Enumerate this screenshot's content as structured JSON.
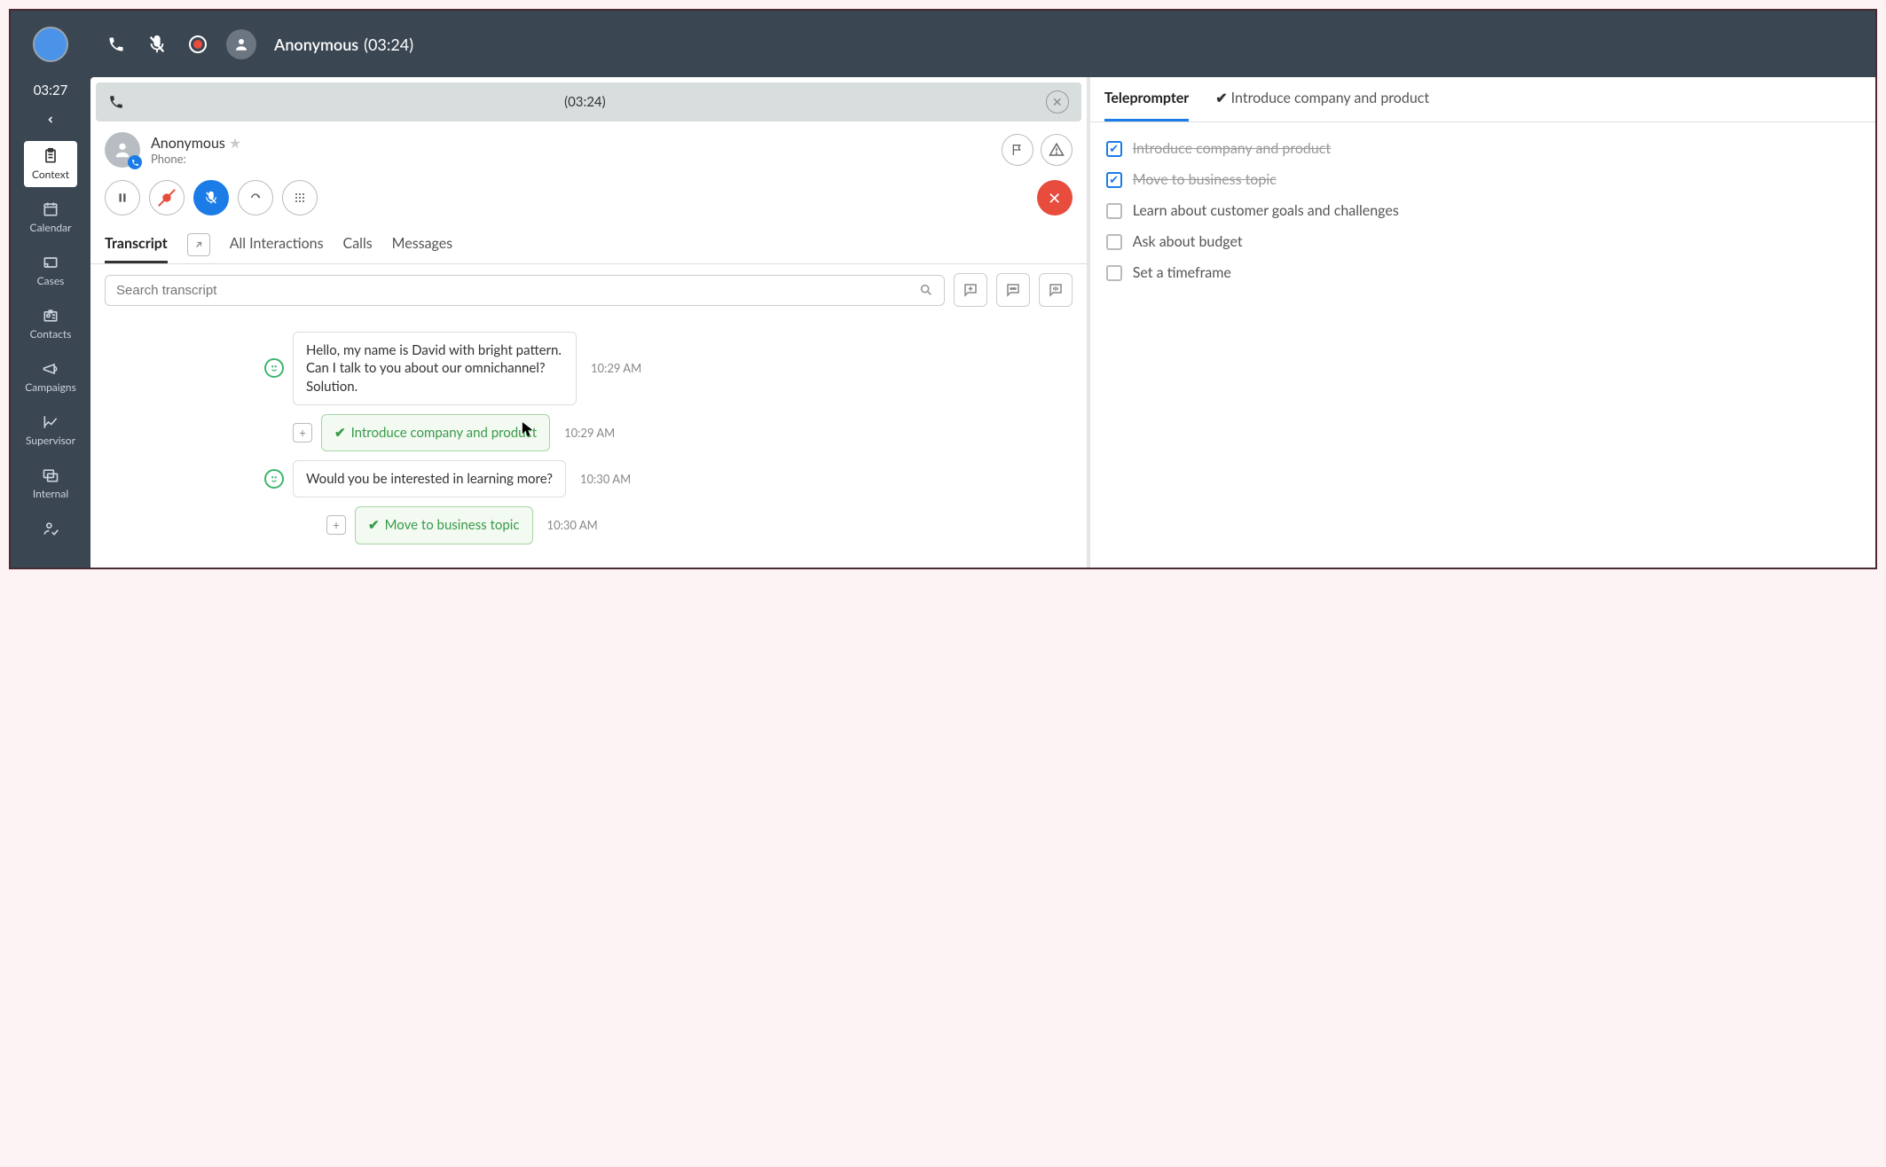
{
  "top": {
    "caller_name": "Anonymous",
    "call_timer_paren": "(03:24)"
  },
  "sidebar": {
    "elapsed": "03:27",
    "items": [
      {
        "label": "Context"
      },
      {
        "label": "Calendar"
      },
      {
        "label": "Cases"
      },
      {
        "label": "Contacts"
      },
      {
        "label": "Campaigns"
      },
      {
        "label": "Supervisor"
      },
      {
        "label": "Internal"
      }
    ]
  },
  "call_strip": {
    "timer": "(03:24)"
  },
  "contact": {
    "name": "Anonymous",
    "phone_label": "Phone:"
  },
  "tabs": {
    "transcript": "Transcript",
    "all": "All Interactions",
    "calls": "Calls",
    "messages": "Messages"
  },
  "search": {
    "placeholder": "Search transcript"
  },
  "transcript": [
    {
      "type": "msg",
      "text": "Hello, my name is David with bright pattern. Can I talk to you about our omnichannel? Solution.",
      "time": "10:29 AM"
    },
    {
      "type": "topic",
      "text": "Introduce company and product",
      "time": "10:29 AM"
    },
    {
      "type": "msg",
      "text": "Would you be interested in learning more?",
      "time": "10:30 AM"
    },
    {
      "type": "topic",
      "text": "Move to business topic",
      "time": "10:30 AM"
    }
  ],
  "right": {
    "tab_teleprompter": "Teleprompter",
    "tab_topic": "Introduce company and product",
    "items": [
      {
        "label": "Introduce company and product",
        "done": true
      },
      {
        "label": "Move to business topic",
        "done": true
      },
      {
        "label": "Learn about customer goals and challenges",
        "done": false
      },
      {
        "label": "Ask about budget",
        "done": false
      },
      {
        "label": "Set a timeframe",
        "done": false
      }
    ]
  }
}
